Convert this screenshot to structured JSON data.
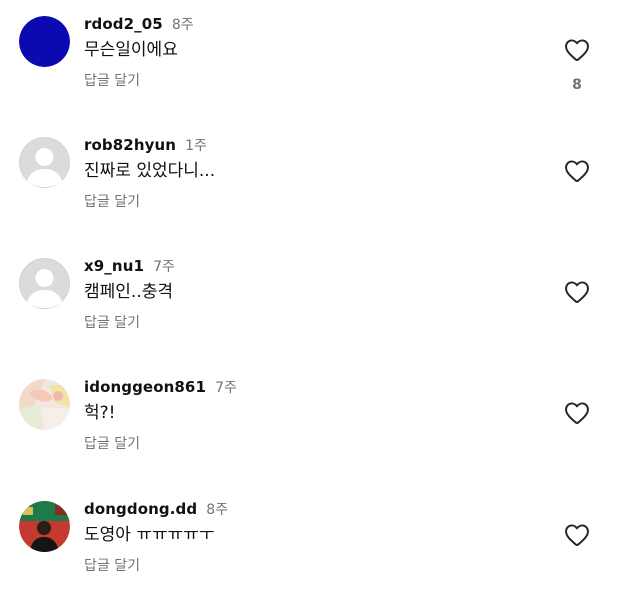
{
  "comments": [
    {
      "username": "rdod2_05",
      "time": "8주",
      "text": "무슨일이에요",
      "reply_label": "답글 달기",
      "like_count": "8",
      "avatar": "solid-blue-avatar"
    },
    {
      "username": "rob82hyun",
      "time": "1주",
      "text": "진짜로 있었다니...",
      "reply_label": "답글 달기",
      "avatar": "default-avatar"
    },
    {
      "username": "x9_nu1",
      "time": "7주",
      "text": "캠페인..충격",
      "reply_label": "답글 달기",
      "avatar": "default-avatar"
    },
    {
      "username": "idonggeon861",
      "time": "7주",
      "text": "헉?!",
      "reply_label": "답글 달기",
      "avatar": "pastel-photo-avatar"
    },
    {
      "username": "dongdong.dd",
      "time": "8주",
      "text": "도영아 ㅠㅠㅠㅠㅜ",
      "reply_label": "답글 달기",
      "avatar": "person-photo-avatar"
    }
  ],
  "colors": {
    "text_primary": "#111111",
    "text_secondary": "#737373",
    "avatar_blue": "#0b0ab0",
    "avatar_default_bg": "#dbdbdb",
    "heart_stroke": "#262626"
  },
  "icons": {
    "like": "heart-outline-icon"
  }
}
